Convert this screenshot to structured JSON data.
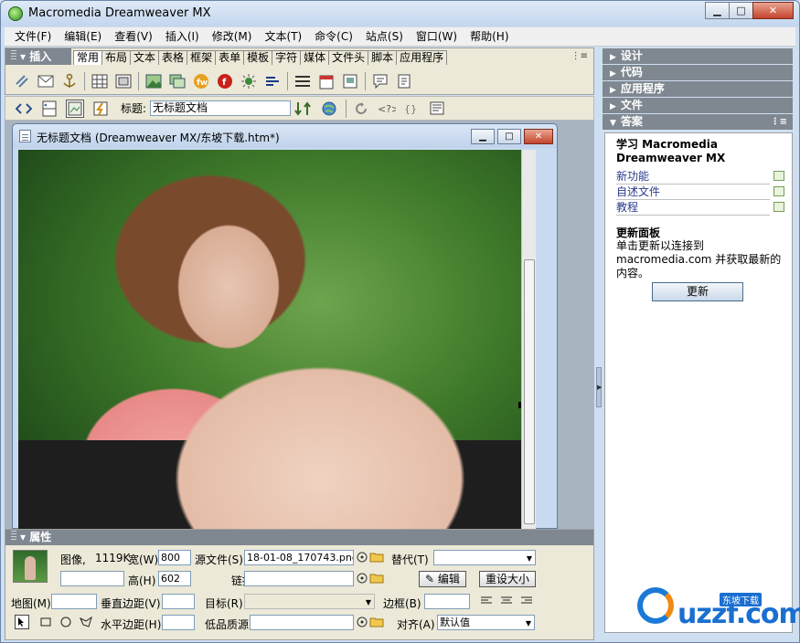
{
  "app": {
    "title": "Macromedia Dreamweaver MX"
  },
  "menu": [
    "文件(F)",
    "编辑(E)",
    "查看(V)",
    "插入(I)",
    "修改(M)",
    "文本(T)",
    "命令(C)",
    "站点(S)",
    "窗口(W)",
    "帮助(H)"
  ],
  "insert_panel": {
    "title": "插入",
    "tabs": [
      "常用",
      "布局",
      "文本",
      "表格",
      "框架",
      "表单",
      "模板",
      "字符",
      "媒体",
      "文件头",
      "脚本",
      "应用程序"
    ],
    "active_tab": "常用"
  },
  "doc_toolbar": {
    "title_label": "标题:",
    "title_value": "无标题文档"
  },
  "document": {
    "title": "无标题文档 (Dreamweaver MX/东坡下载.htm*)"
  },
  "properties": {
    "title": "属性",
    "image_label": "图像,",
    "size": "1119K",
    "width_label": "宽(W)",
    "width": "800",
    "height_label": "高(H)",
    "height": "602",
    "src_label": "源文件(S)",
    "src": "18-01-08_170743.png",
    "alt_label": "替代(T)",
    "link_label": "链接(L)",
    "edit_button": "编辑",
    "reset_button": "重设大小",
    "map_label": "地图(M)",
    "vspace_label": "垂直边距(V)",
    "target_label": "目标(R)",
    "border_label": "边框(B)",
    "hspace_label": "水平边距(H)",
    "lowsrc_label": "低品质源",
    "align_label": "对齐(A)",
    "align_value": "默认值"
  },
  "right_panels": [
    "设计",
    "代码",
    "应用程序",
    "文件",
    "答案"
  ],
  "answers": {
    "heading": "学习 Macromedia Dreamweaver MX",
    "links": [
      "新功能",
      "自述文件",
      "教程"
    ],
    "update_title": "更新面板",
    "update_text": "单击更新以连接到 macromedia.com 并获取最新的内容。",
    "update_button": "更新"
  },
  "watermark": {
    "text": "uzzf.com",
    "badge": "东坡下载"
  }
}
